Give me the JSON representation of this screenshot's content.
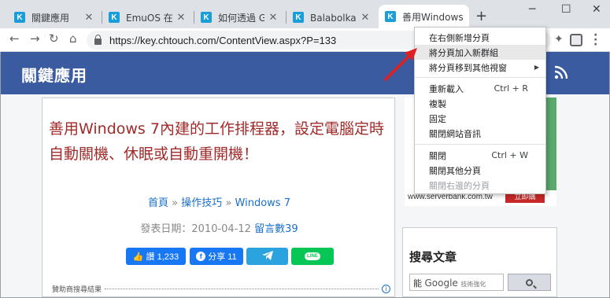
{
  "tabs": [
    {
      "title": "關鍵應用",
      "icon": "K"
    },
    {
      "title": "EmuOS 在瀏覽器",
      "icon": "K"
    },
    {
      "title": "如何透過 Google",
      "icon": "K"
    },
    {
      "title": "Balabolka 文字",
      "icon": "K"
    },
    {
      "title": "善用Windows",
      "icon": "K"
    }
  ],
  "toolbar": {
    "url": "https://key.chtouch.com/ContentView.aspx?P=133"
  },
  "site": {
    "title": "關鍵應用"
  },
  "article": {
    "title": "善用Windows 7內建的工作排程器，設定電腦定時自動關機、休眠或自動重開機！",
    "breadcrumb": [
      "首頁",
      "操作技巧",
      "Windows 7"
    ],
    "breadcrumb_sep": "»",
    "publish_label": "發表日期：2010-04-12",
    "comments_label": "留言數39",
    "share": {
      "like": "讚 1,233",
      "fb": "分享 11",
      "line": "LINE"
    },
    "ad_label": "贊助商搜尋結果"
  },
  "sidebar": {
    "ad_url": "www.serverbank.com.tw",
    "ad_button": "立即購",
    "search_title": "搜尋文章",
    "search_prefix": "能",
    "search_google": "Google",
    "search_suffix": "技術強化"
  },
  "context_menu": {
    "items": [
      {
        "label": "在右側新增分頁",
        "shortcut": ""
      },
      {
        "label": "將分頁加入新群組",
        "shortcut": ""
      },
      {
        "label": "將分頁移到其他視窗",
        "shortcut": ""
      },
      {
        "label": "重新載入",
        "shortcut": "Ctrl + R"
      },
      {
        "label": "複製",
        "shortcut": ""
      },
      {
        "label": "固定",
        "shortcut": ""
      },
      {
        "label": "關閉網站音訊",
        "shortcut": ""
      },
      {
        "label": "關閉",
        "shortcut": "Ctrl + W"
      },
      {
        "label": "關閉其他分頁",
        "shortcut": ""
      },
      {
        "label": "關閉右邊的分頁",
        "shortcut": ""
      }
    ]
  },
  "colors": {
    "header_bg": "#3a5ba0",
    "title_red": "#a12a2a",
    "link_blue": "#1a6fc9",
    "favicon": "#1a9ed9"
  }
}
